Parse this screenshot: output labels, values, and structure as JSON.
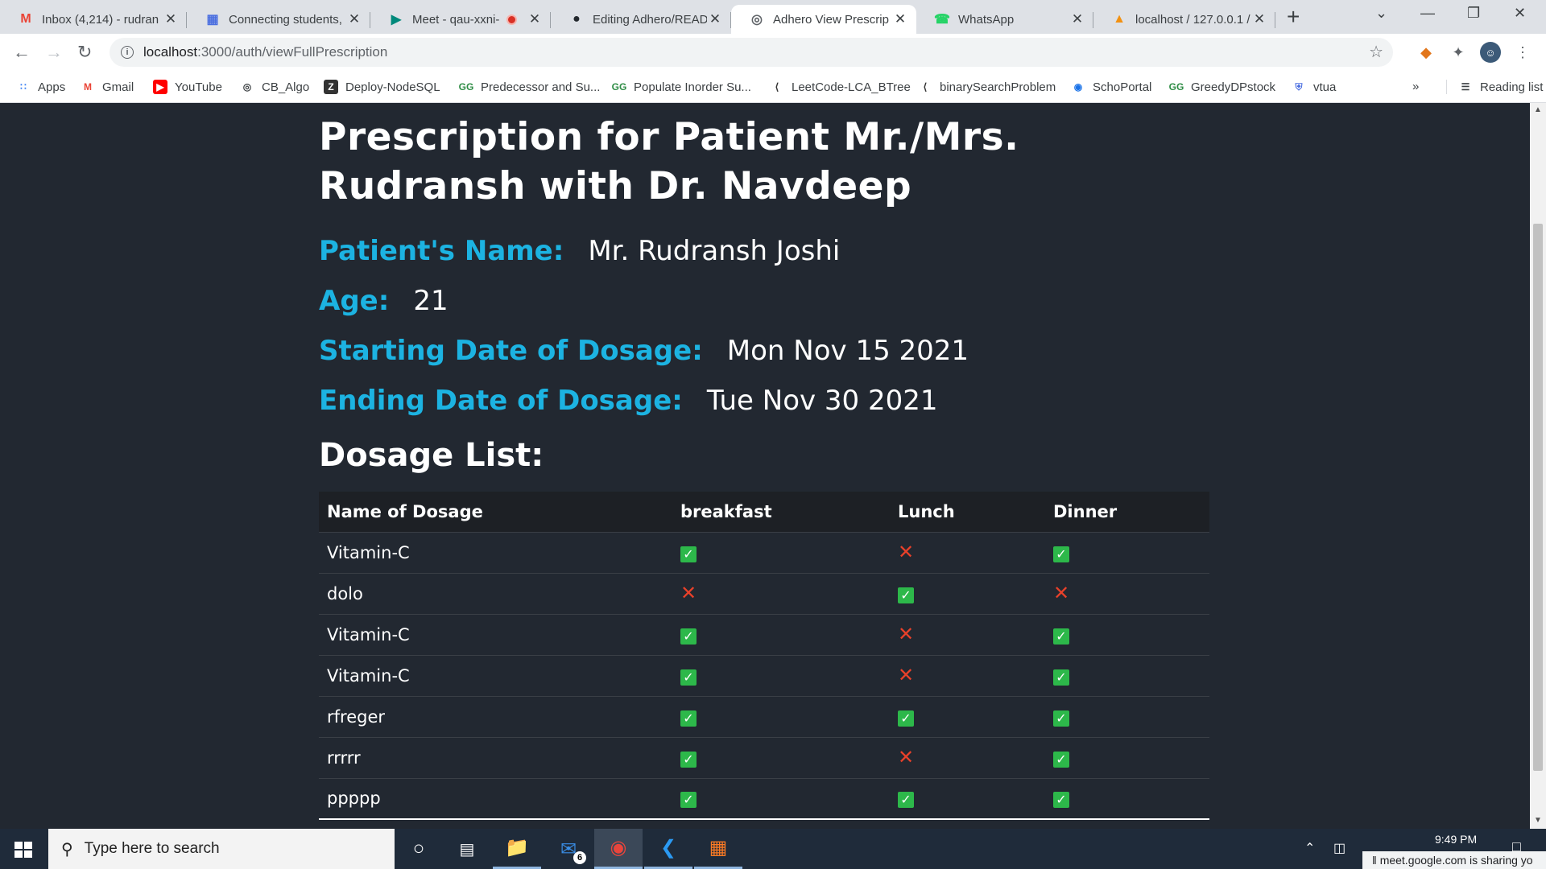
{
  "browser": {
    "tabs": [
      {
        "title": "Inbox (4,214) - rudran",
        "icon": "gmail-icon",
        "active": false
      },
      {
        "title": "Connecting students,",
        "icon": "docs-icon",
        "active": false
      },
      {
        "title": "Meet - qau-xxni-",
        "icon": "meet-icon",
        "active": false,
        "recording": true
      },
      {
        "title": "Editing Adhero/READ",
        "icon": "github-icon",
        "active": false
      },
      {
        "title": "Adhero View Prescrip",
        "icon": "globe-icon",
        "active": true
      },
      {
        "title": "WhatsApp",
        "icon": "whatsapp-icon",
        "active": false
      },
      {
        "title": "localhost / 127.0.0.1 /",
        "icon": "phpmyadmin-icon",
        "active": false
      }
    ],
    "address": {
      "host": "localhost",
      "path": ":3000/auth/viewFullPrescription"
    },
    "bookmarks": [
      {
        "label": "Apps",
        "icon": "apps-grid-icon"
      },
      {
        "label": "Gmail",
        "icon": "gmail-icon"
      },
      {
        "label": "YouTube",
        "icon": "youtube-icon"
      },
      {
        "label": "CB_Algo",
        "icon": "globe-icon"
      },
      {
        "label": "Deploy-NodeSQL",
        "icon": "bookmark-z-icon"
      },
      {
        "label": "Predecessor and Su...",
        "icon": "geeksforgeeks-icon"
      },
      {
        "label": "Populate Inorder Su...",
        "icon": "geeksforgeeks-icon"
      },
      {
        "label": "LeetCode-LCA_BTree",
        "icon": "leetcode-icon"
      },
      {
        "label": "binarySearchProblem",
        "icon": "leetcode-icon"
      },
      {
        "label": "SchoPortal",
        "icon": "schoportal-icon"
      },
      {
        "label": "GreedyDPstock",
        "icon": "geeksforgeeks-icon"
      },
      {
        "label": "vtua",
        "icon": "shield-icon"
      }
    ],
    "more_bookmarks": "»",
    "reading_list": "Reading list"
  },
  "page": {
    "title": "Prescription for Patient Mr./Mrs. Rudransh with Dr. Navdeep",
    "patient_name_label": "Patient's Name:",
    "patient_name": "Mr. Rudransh Joshi",
    "age_label": "Age:",
    "age": "21",
    "start_label": "Starting Date of Dosage:",
    "start_date": "Mon Nov 15 2021",
    "end_label": "Ending Date of Dosage:",
    "end_date": "Tue Nov 30 2021",
    "dosage_heading": "Dosage List:",
    "table": {
      "columns": [
        "Name of Dosage",
        "breakfast",
        "Lunch",
        "Dinner"
      ],
      "rows": [
        {
          "name": "Vitamin-C",
          "breakfast": true,
          "lunch": false,
          "dinner": true
        },
        {
          "name": "dolo",
          "breakfast": false,
          "lunch": true,
          "dinner": false
        },
        {
          "name": "Vitamin-C",
          "breakfast": true,
          "lunch": false,
          "dinner": true
        },
        {
          "name": "Vitamin-C",
          "breakfast": true,
          "lunch": false,
          "dinner": true
        },
        {
          "name": "rfreger",
          "breakfast": true,
          "lunch": true,
          "dinner": true
        },
        {
          "name": "rrrrr",
          "breakfast": true,
          "lunch": false,
          "dinner": true
        },
        {
          "name": "ppppp",
          "breakfast": true,
          "lunch": true,
          "dinner": true
        }
      ]
    }
  },
  "colors": {
    "label_accent": "#1cb3e2",
    "background": "#222831",
    "check": "#2db84a",
    "cross": "#e8412a"
  },
  "taskbar": {
    "search_placeholder": "Type here to search",
    "mail_badge": "6",
    "clock": "9:49 PM",
    "sharing_notice": "meet.google.com is sharing yo"
  }
}
